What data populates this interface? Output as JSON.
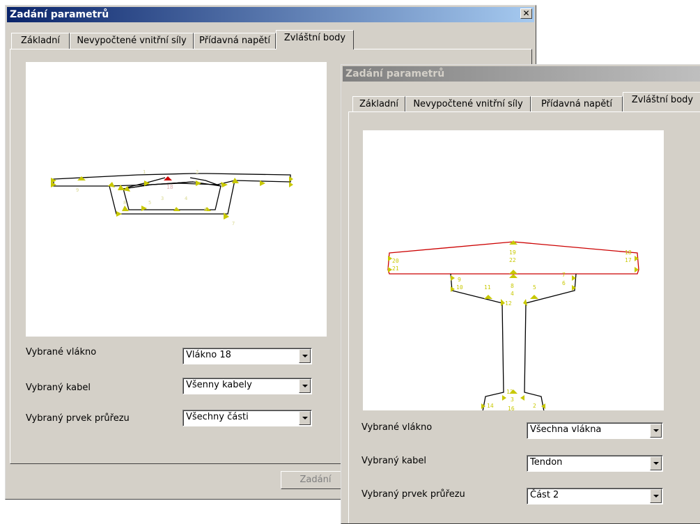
{
  "window1": {
    "title": "Zadání parametrů",
    "close_glyph": "✕",
    "tabs": [
      "Základní",
      "Nevypočtené vnitřní síly",
      "Přídavná napětí",
      "Zvláštní body"
    ],
    "active_tab": 3,
    "fields": {
      "fiber_label": "Vybrané vlákno",
      "fiber_value": "Vlákno 18",
      "cable_label": "Vybraný kabel",
      "cable_value": "Všenny kabely",
      "part_label": "Vybraný prvek průřezu",
      "part_value": "Všechny části"
    },
    "ok_button": "Zadání",
    "point_labels": [
      "1",
      "2",
      "3",
      "4",
      "5",
      "6",
      "7",
      "8",
      "9",
      "18"
    ]
  },
  "window2": {
    "title": "Zadání parametrů",
    "tabs": [
      "Základní",
      "Nevypočtené vnitřní síly",
      "Přídavná napětí",
      "Zvláštní body"
    ],
    "active_tab": 3,
    "fields": {
      "fiber_label": "Vybrané vlákno",
      "fiber_value": "Všechna vlákna",
      "cable_label": "Vybraný kabel",
      "cable_value": "Tendon",
      "part_label": "Vybraný prvek průřezu",
      "part_value": "Část 2"
    },
    "point_labels": {
      "p20": "20",
      "p21": "21",
      "p19": "19",
      "p22": "22",
      "p18": "18",
      "p17": "17",
      "p9": "9",
      "p10": "10",
      "p11": "11",
      "p8": "8",
      "p4": "4",
      "p5": "5",
      "p7": "7",
      "p6": "6",
      "p12": "12",
      "p13": "13",
      "p3": "3",
      "p14": "14",
      "p15": "15",
      "p16": "16",
      "p2": "2",
      "p1": "1"
    }
  },
  "colors": {
    "title_active": "#0a246a",
    "title_inactive": "#808080",
    "section_line": "#000000",
    "highlight_line": "#d40000",
    "point_marker": "#c8c800",
    "selected_point": "#cc0000"
  }
}
